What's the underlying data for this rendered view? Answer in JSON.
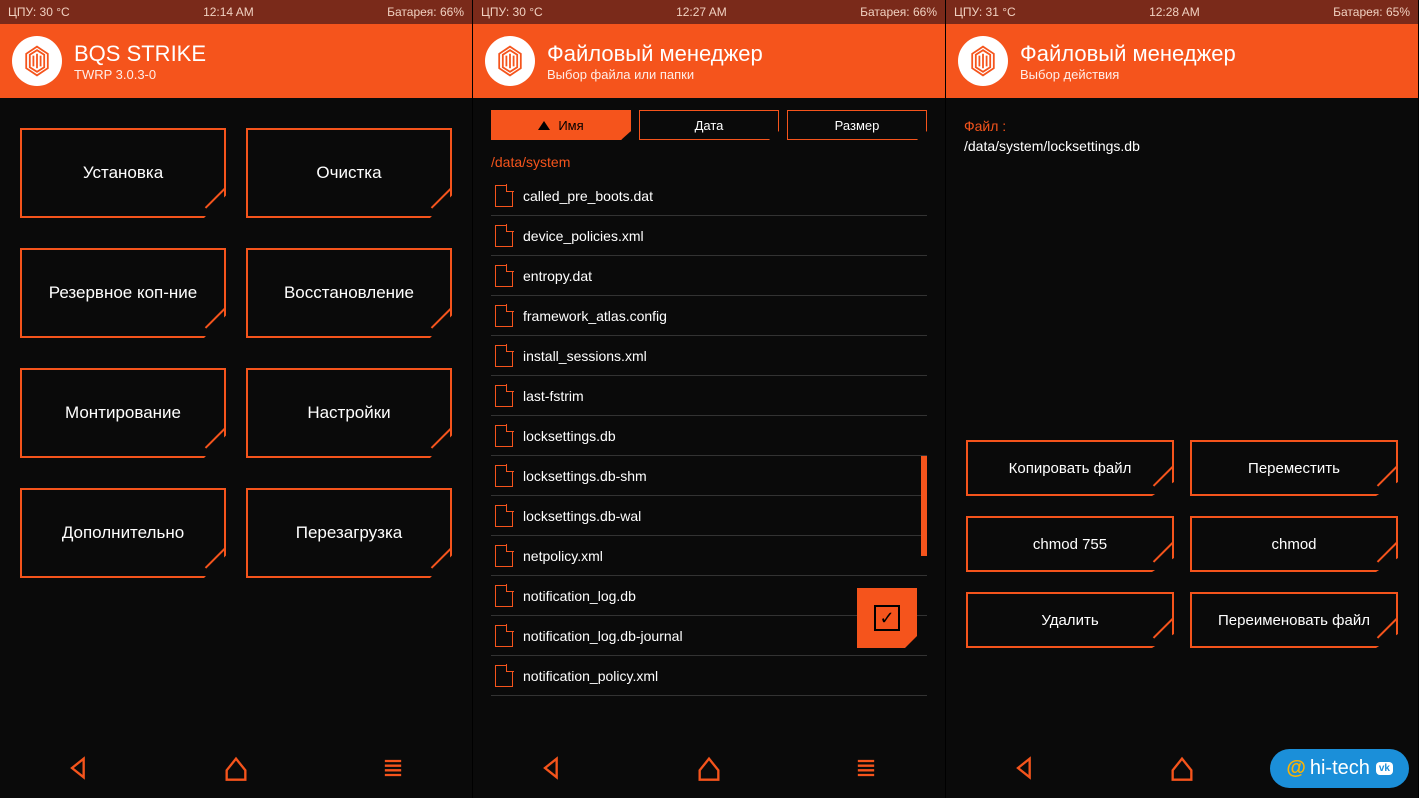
{
  "screens": [
    {
      "status": {
        "cpu": "ЦПУ: 30 °C",
        "time": "12:14 AM",
        "battery": "Батарея: 66%"
      },
      "header": {
        "title": "BQS STRIKE",
        "subtitle": "TWRP 3.0.3-0"
      },
      "buttons": [
        "Установка",
        "Очистка",
        "Резервное коп-ние",
        "Восстановление",
        "Монтирование",
        "Настройки",
        "Дополнительно",
        "Перезагрузка"
      ]
    },
    {
      "status": {
        "cpu": "ЦПУ: 30 °C",
        "time": "12:27 AM",
        "battery": "Батарея: 66%"
      },
      "header": {
        "title": "Файловый менеджер",
        "subtitle": "Выбор файла или папки"
      },
      "sort": {
        "name": "Имя",
        "date": "Дата",
        "size": "Размер"
      },
      "path": "/data/system",
      "files": [
        "called_pre_boots.dat",
        "device_policies.xml",
        "entropy.dat",
        "framework_atlas.config",
        "install_sessions.xml",
        "last-fstrim",
        "locksettings.db",
        "locksettings.db-shm",
        "locksettings.db-wal",
        "netpolicy.xml",
        "notification_log.db",
        "notification_log.db-journal",
        "notification_policy.xml"
      ]
    },
    {
      "status": {
        "cpu": "ЦПУ: 31 °C",
        "time": "12:28 AM",
        "battery": "Батарея: 65%"
      },
      "header": {
        "title": "Файловый менеджер",
        "subtitle": "Выбор действия"
      },
      "file_label": "Файл :",
      "file_path": "/data/system/locksettings.db",
      "actions": [
        "Копировать файл",
        "Переместить",
        "chmod 755",
        "chmod",
        "Удалить",
        "Переименовать файл"
      ]
    }
  ],
  "watermark": {
    "at": "@",
    "text": "hi-tech",
    "badge": "vk"
  }
}
